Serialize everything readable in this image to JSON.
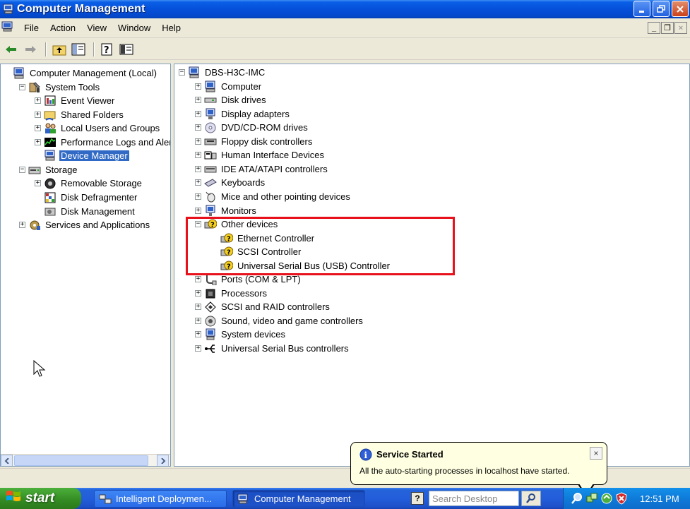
{
  "window": {
    "title": "Computer Management"
  },
  "menu": {
    "items": [
      "File",
      "Action",
      "View",
      "Window",
      "Help"
    ],
    "mdi_min": "_",
    "mdi_restore": "❐",
    "mdi_close": "×"
  },
  "left_tree": [
    {
      "id": "root",
      "label": "Computer Management (Local)",
      "expander": "",
      "icon": "computer-icon",
      "depth": 0
    },
    {
      "id": "system-tools",
      "label": "System Tools",
      "expander": "−",
      "icon": "tools-icon",
      "depth": 1
    },
    {
      "id": "event-viewer",
      "label": "Event Viewer",
      "expander": "+",
      "icon": "event-viewer-icon",
      "depth": 2
    },
    {
      "id": "shared-folders",
      "label": "Shared Folders",
      "expander": "+",
      "icon": "shared-folder-icon",
      "depth": 2
    },
    {
      "id": "local-users",
      "label": "Local Users and Groups",
      "expander": "+",
      "icon": "users-icon",
      "depth": 2
    },
    {
      "id": "perf-logs",
      "label": "Performance Logs and Alerts",
      "expander": "+",
      "icon": "performance-icon",
      "depth": 2
    },
    {
      "id": "device-manager",
      "label": "Device Manager",
      "expander": "",
      "icon": "device-manager-icon",
      "depth": 2,
      "selected": true
    },
    {
      "id": "storage",
      "label": "Storage",
      "expander": "−",
      "icon": "storage-icon",
      "depth": 1
    },
    {
      "id": "removable-storage",
      "label": "Removable Storage",
      "expander": "+",
      "icon": "removable-storage-icon",
      "depth": 2
    },
    {
      "id": "disk-defrag",
      "label": "Disk Defragmenter",
      "expander": "",
      "icon": "defrag-icon",
      "depth": 2
    },
    {
      "id": "disk-management",
      "label": "Disk Management",
      "expander": "",
      "icon": "disk-management-icon",
      "depth": 2
    },
    {
      "id": "services-apps",
      "label": "Services and Applications",
      "expander": "+",
      "icon": "services-icon",
      "depth": 1
    }
  ],
  "right_tree": [
    {
      "label": "DBS-H3C-IMC",
      "expander": "−",
      "icon": "computer-icon",
      "depth": 0
    },
    {
      "label": "Computer",
      "expander": "+",
      "icon": "computer-icon",
      "depth": 1
    },
    {
      "label": "Disk drives",
      "expander": "+",
      "icon": "disk-drive-icon",
      "depth": 1
    },
    {
      "label": "Display adapters",
      "expander": "+",
      "icon": "display-adapter-icon",
      "depth": 1
    },
    {
      "label": "DVD/CD-ROM drives",
      "expander": "+",
      "icon": "dvd-drive-icon",
      "depth": 1
    },
    {
      "label": "Floppy disk controllers",
      "expander": "+",
      "icon": "floppy-controller-icon",
      "depth": 1
    },
    {
      "label": "Human Interface Devices",
      "expander": "+",
      "icon": "hid-icon",
      "depth": 1
    },
    {
      "label": "IDE ATA/ATAPI controllers",
      "expander": "+",
      "icon": "ide-controller-icon",
      "depth": 1
    },
    {
      "label": "Keyboards",
      "expander": "+",
      "icon": "keyboard-icon",
      "depth": 1
    },
    {
      "label": "Mice and other pointing devices",
      "expander": "+",
      "icon": "mouse-icon",
      "depth": 1
    },
    {
      "label": "Monitors",
      "expander": "+",
      "icon": "monitor-icon",
      "depth": 1
    },
    {
      "label": "Other devices",
      "expander": "−",
      "icon": "unknown-device-icon",
      "depth": 1
    },
    {
      "label": "Ethernet Controller",
      "expander": "",
      "icon": "unknown-device-icon",
      "depth": 2
    },
    {
      "label": "SCSI Controller",
      "expander": "",
      "icon": "unknown-device-icon",
      "depth": 2
    },
    {
      "label": "Universal Serial Bus (USB) Controller",
      "expander": "",
      "icon": "unknown-device-icon",
      "depth": 2
    },
    {
      "label": "Ports (COM & LPT)",
      "expander": "+",
      "icon": "port-icon",
      "depth": 1
    },
    {
      "label": "Processors",
      "expander": "+",
      "icon": "processor-icon",
      "depth": 1
    },
    {
      "label": "SCSI and RAID controllers",
      "expander": "+",
      "icon": "scsi-raid-icon",
      "depth": 1
    },
    {
      "label": "Sound, video and game controllers",
      "expander": "+",
      "icon": "sound-icon",
      "depth": 1
    },
    {
      "label": "System devices",
      "expander": "+",
      "icon": "system-devices-icon",
      "depth": 1
    },
    {
      "label": "Universal Serial Bus controllers",
      "expander": "+",
      "icon": "usb-icon",
      "depth": 1
    }
  ],
  "balloon": {
    "title": "Service Started",
    "text": "All the auto-starting processes in localhost have started.",
    "close": "×"
  },
  "taskbar": {
    "start_label": "start",
    "tasks": [
      {
        "label": "Intelligent Deploymen...",
        "active": false
      },
      {
        "label": "Computer Management",
        "active": true
      }
    ],
    "help_glyph": "?",
    "search_placeholder": "Search Desktop",
    "clock": "12:51 PM"
  },
  "colors": {
    "selection": "#316AC5",
    "highlight_box": "#E8101B",
    "titlebar": "#0550DA",
    "balloon_bg": "#FFFFE1"
  }
}
